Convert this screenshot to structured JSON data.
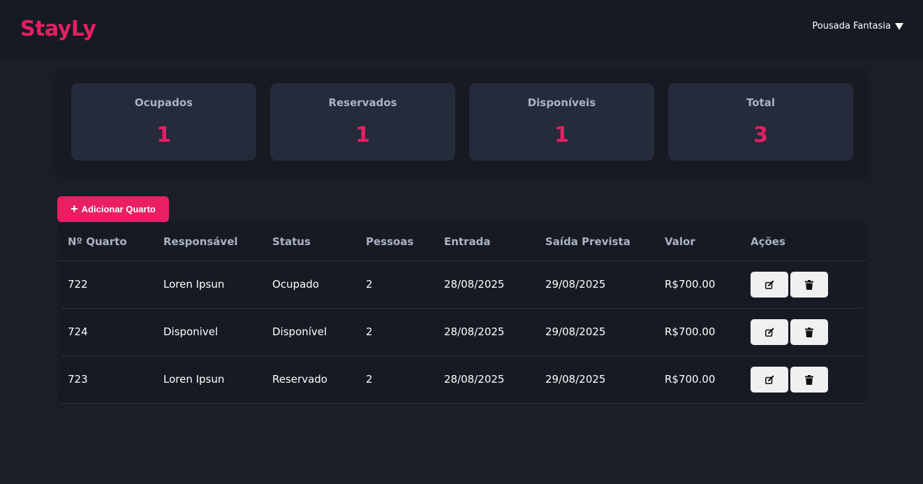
{
  "header": {
    "brand": "StayLy",
    "hotel_selector": "Pousada Fantasia",
    "caret_icon": "caret-down-icon"
  },
  "stats": [
    {
      "label": "Ocupados",
      "value": "1"
    },
    {
      "label": "Reservados",
      "value": "1"
    },
    {
      "label": "Disponíveis",
      "value": "1"
    },
    {
      "label": "Total",
      "value": "3"
    }
  ],
  "actions": {
    "add_room_label": "Adicionar Quarto",
    "add_icon": "plus-icon"
  },
  "table": {
    "columns": [
      "Nº Quarto",
      "Responsável",
      "Status",
      "Pessoas",
      "Entrada",
      "Saída Prevista",
      "Valor",
      "Ações"
    ],
    "rows": [
      {
        "room": "722",
        "guest": "Loren Ipsun",
        "status": "Ocupado",
        "people": "2",
        "checkin": "28/08/2025",
        "checkout": "29/08/2025",
        "value": "R$700.00"
      },
      {
        "room": "724",
        "guest": "Disponivel",
        "status": "Disponível",
        "people": "2",
        "checkin": "28/08/2025",
        "checkout": "29/08/2025",
        "value": "R$700.00"
      },
      {
        "room": "723",
        "guest": "Loren Ipsun",
        "status": "Reservado",
        "people": "2",
        "checkin": "28/08/2025",
        "checkout": "29/08/2025",
        "value": "R$700.00"
      }
    ],
    "row_icons": {
      "edit": "edit-icon",
      "delete": "trash-icon"
    }
  },
  "colors": {
    "accent": "#e91e63",
    "background": "#1a1e29",
    "panel": "#161a23",
    "card": "#252b3b"
  }
}
